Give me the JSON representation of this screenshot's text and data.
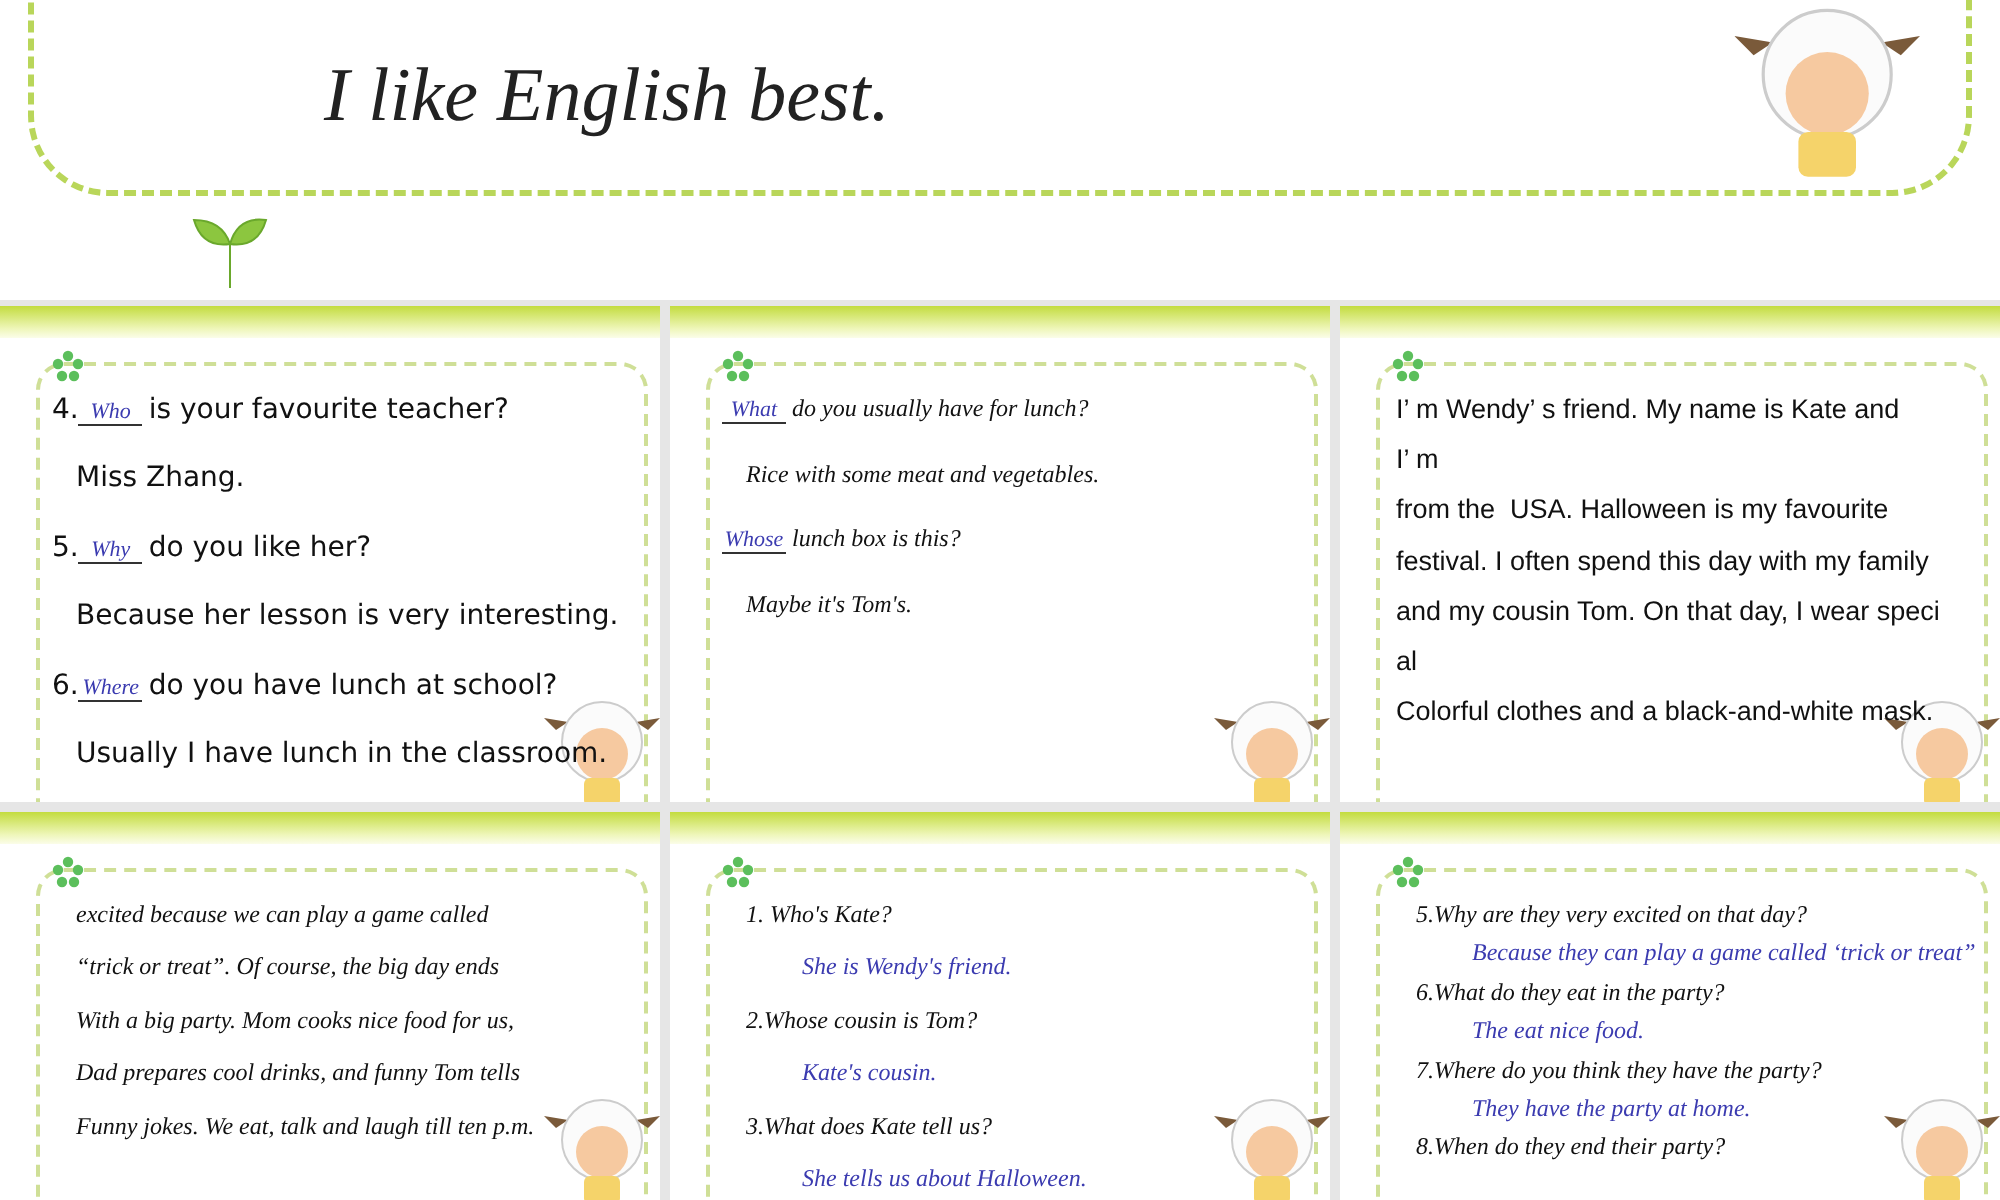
{
  "banner": {
    "title": "I like English best."
  },
  "slides": [
    {
      "lines": [
        {
          "kind": "blank",
          "number": "4.",
          "answer": "Who",
          "text": "is your favourite teacher?"
        },
        {
          "kind": "text",
          "text": "Miss Zhang."
        },
        {
          "kind": "blank",
          "number": "5.",
          "answer": "Why",
          "text": "do you like her?"
        },
        {
          "kind": "text",
          "text": "Because her lesson is very interesting."
        },
        {
          "kind": "blank",
          "number": "6.",
          "answer": "Where",
          "text": "do you have lunch at school?"
        },
        {
          "kind": "text",
          "text": "Usually I have lunch in the classroom."
        }
      ]
    },
    {
      "lines": [
        {
          "kind": "blank",
          "answer": "What",
          "text": "do you usually have for lunch?"
        },
        {
          "kind": "text",
          "text": "Rice with some meat and vegetables."
        },
        {
          "kind": "blank",
          "answer": "Whose",
          "text": "lunch box is this?"
        },
        {
          "kind": "text",
          "text": "Maybe it's Tom's."
        }
      ]
    },
    {
      "lines": [
        {
          "kind": "text",
          "text": "I’ m Wendy’ s friend. My name is Kate and"
        },
        {
          "kind": "text",
          "text": "I’ m"
        },
        {
          "kind": "text",
          "text": "from the  USA. Halloween is my favourite"
        },
        {
          "kind": "text",
          "text": "festival. I often spend this day with my family"
        },
        {
          "kind": "text",
          "text": "and my cousin Tom. On that day, I wear speci"
        },
        {
          "kind": "text",
          "text": "al"
        },
        {
          "kind": "text",
          "text": "Colorful clothes and a black-and-white mask."
        }
      ]
    },
    {
      "lines": [
        {
          "kind": "text",
          "text": "excited because we can play a game called"
        },
        {
          "kind": "text",
          "text": "“trick or treat”. Of course, the big day ends"
        },
        {
          "kind": "text",
          "text": "With a big party. Mom cooks nice food for us,"
        },
        {
          "kind": "text",
          "text": "Dad prepares cool drinks, and funny Tom tells"
        },
        {
          "kind": "text",
          "text": "Funny jokes. We eat, talk and laugh till ten p.m."
        }
      ]
    },
    {
      "lines": [
        {
          "kind": "text",
          "text": "1. Who's Kate?"
        },
        {
          "kind": "answer",
          "text": "She is Wendy's friend."
        },
        {
          "kind": "text",
          "text": "2.Whose cousin is Tom?"
        },
        {
          "kind": "answer",
          "text": "Kate's cousin."
        },
        {
          "kind": "text",
          "text": "3.What does Kate tell us?"
        },
        {
          "kind": "answer",
          "text": "She tells us about Halloween."
        }
      ]
    },
    {
      "lines": [
        {
          "kind": "text",
          "text": "5.Why are they very excited on that day?"
        },
        {
          "kind": "answer",
          "text": "Because they can play a game called ‘trick or treat”"
        },
        {
          "kind": "text",
          "text": "6.What do they eat in the party?"
        },
        {
          "kind": "answer",
          "text": "The eat nice food."
        },
        {
          "kind": "text",
          "text": "7.Where do you think they have the party?"
        },
        {
          "kind": "answer",
          "text": "They have the party at home."
        },
        {
          "kind": "text",
          "text": "8.When do they end their party?"
        }
      ]
    }
  ]
}
